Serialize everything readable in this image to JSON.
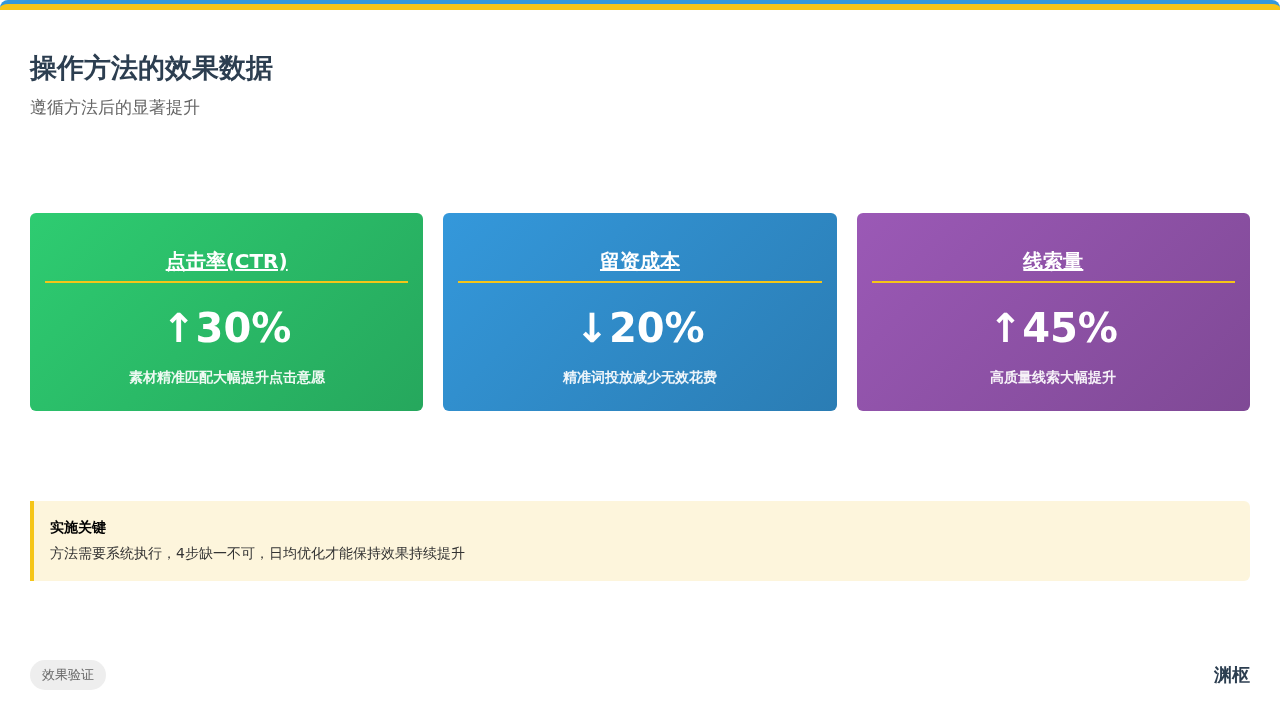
{
  "title": "操作方法的效果数据",
  "subtitle": "遵循方法后的显著提升",
  "cards": [
    {
      "label": "点击率(CTR)",
      "value": "↑30%",
      "description": "素材精准匹配大幅提升点击意愿",
      "color": "#2ecc71"
    },
    {
      "label": "留资成本",
      "value": "↓20%",
      "description": "精准词投放减少无效花费",
      "color": "#3498db"
    },
    {
      "label": "线索量",
      "value": "↑45%",
      "description": "高质量线索大幅提升",
      "color": "#9b59b6"
    }
  ],
  "note": {
    "title": "实施关键",
    "text": "方法需要系统执行，4步缺一不可，日均优化才能保持效果持续提升"
  },
  "footer": {
    "tag": "效果验证",
    "brand": "渊枢"
  }
}
